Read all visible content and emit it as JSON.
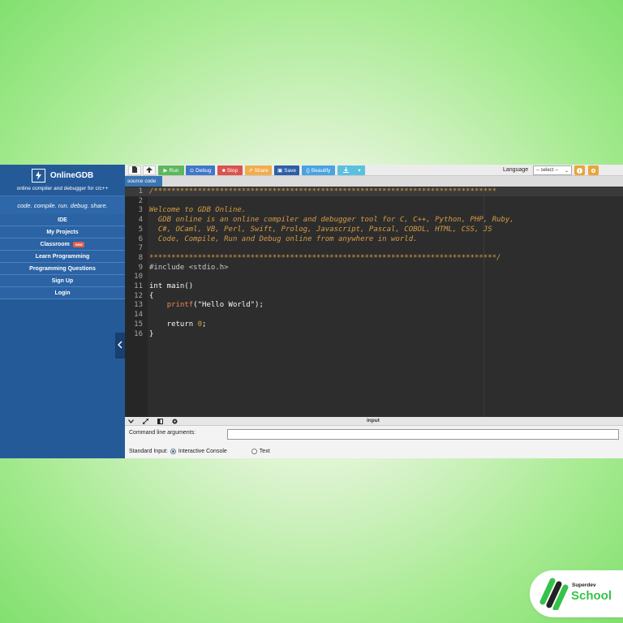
{
  "sidebar": {
    "brand_name": "OnlineGDB",
    "brand_sub": "online compiler and debugger for c/c++",
    "tagline": "code. compile. run. debug. share.",
    "items": [
      {
        "label": "IDE"
      },
      {
        "label": "My Projects"
      },
      {
        "label": "Classroom",
        "badge": "new"
      },
      {
        "label": "Learn Programming"
      },
      {
        "label": "Programming Questions"
      },
      {
        "label": "Sign Up"
      },
      {
        "label": "Login"
      }
    ],
    "collapse_icon": "chevron-left-icon"
  },
  "toolbar": {
    "new_icon": "new-file-icon",
    "upload_icon": "upload-icon",
    "run_label": "Run",
    "debug_label": "Debug",
    "stop_label": "Stop",
    "share_label": "Share",
    "save_label": "Save",
    "beautify_label": "Beautify",
    "download_icon": "download-icon",
    "dropdown_icon": "caret-down-icon",
    "language_label": "Language",
    "language_value": "-- select --",
    "info_icon": "info-icon",
    "settings_icon": "gear-icon",
    "colors": {
      "run": "#5cb85c",
      "debug": "#3f78c9",
      "stop": "#d9534f",
      "share": "#f0ad4e",
      "save": "#2c5fa5",
      "beautify": "#4aa3df",
      "download": "#5bc0de"
    }
  },
  "tab": {
    "label": "source code"
  },
  "editor": {
    "lines": [
      {
        "n": "1",
        "text": "/******************************************************************************",
        "kind": "cmt"
      },
      {
        "n": "2",
        "text": "",
        "kind": "cmt"
      },
      {
        "n": "3",
        "text": "Welcome to GDB Online.",
        "kind": "cmt"
      },
      {
        "n": "4",
        "text": "  GDB online is an online compiler and debugger tool for C, C++, Python, PHP, Ruby,",
        "kind": "cmt"
      },
      {
        "n": "5",
        "text": "  C#, OCaml, VB, Perl, Swift, Prolog, Javascript, Pascal, COBOL, HTML, CSS, JS",
        "kind": "cmt"
      },
      {
        "n": "6",
        "text": "  Code, Compile, Run and Debug online from anywhere in world.",
        "kind": "cmt"
      },
      {
        "n": "7",
        "text": "",
        "kind": "cmt"
      },
      {
        "n": "8",
        "text": "*******************************************************************************/",
        "kind": "cmt"
      },
      {
        "n": "9",
        "text": "#include <stdio.h>",
        "kind": "pre"
      },
      {
        "n": "10",
        "text": "",
        "kind": "plain"
      },
      {
        "n": "11",
        "text": "int main()",
        "kind": "plain"
      },
      {
        "n": "12",
        "text": "{",
        "kind": "plain"
      },
      {
        "n": "13",
        "text": "    printf(\"Hello World\");",
        "kind": "printf"
      },
      {
        "n": "14",
        "text": "",
        "kind": "plain"
      },
      {
        "n": "15",
        "text": "    return 0;",
        "kind": "return"
      },
      {
        "n": "16",
        "text": "}",
        "kind": "plain"
      }
    ]
  },
  "panel": {
    "title": "input",
    "collapse_icon": "chevron-down-icon",
    "expand_icon": "expand-icon",
    "split_icon": "split-view-icon",
    "settings_icon": "gear-icon",
    "cmd_label": "Command line arguments:",
    "cmd_value": "",
    "stdin_label": "Standard Input:",
    "opt_interactive": "Interactive Console",
    "opt_text": "Text",
    "selected": "Interactive Console"
  },
  "school_badge": {
    "small": "Superdev",
    "big": "School",
    "logo_icon": "superdev-stripes-icon",
    "color": "#36c24a"
  }
}
